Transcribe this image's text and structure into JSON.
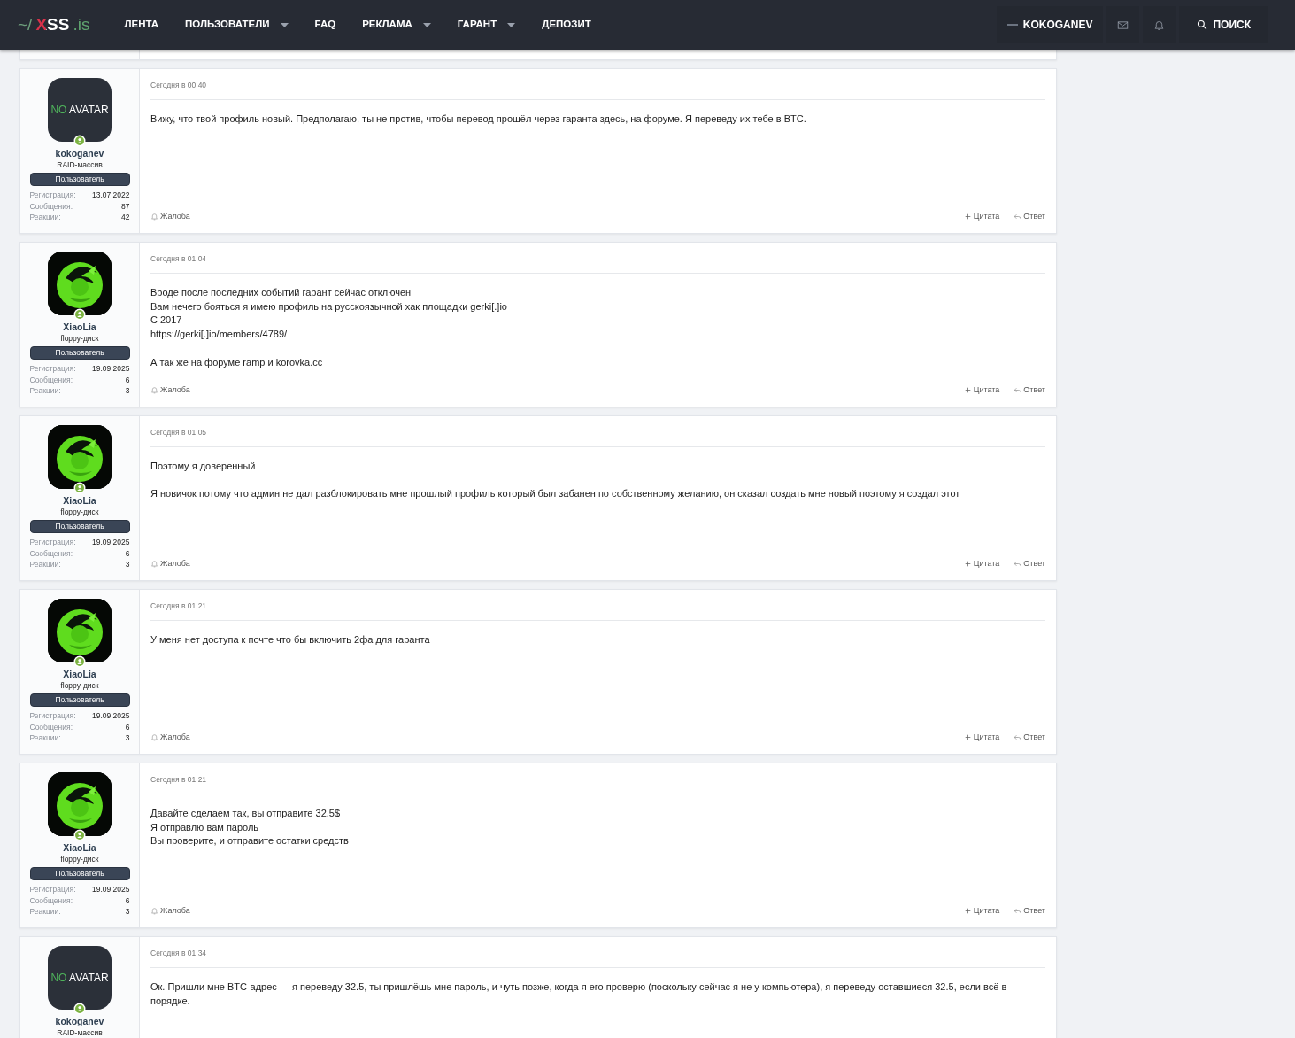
{
  "header": {
    "logo": {
      "prefix": "~/",
      "name": "XSS",
      "suffix": ".is"
    },
    "nav": [
      {
        "label": "ЛЕНТА",
        "dropdown": false
      },
      {
        "label": "ПОЛЬЗОВАТЕЛИ",
        "dropdown": true
      },
      {
        "label": "FAQ",
        "dropdown": false
      },
      {
        "label": "РЕКЛАМА",
        "dropdown": true
      },
      {
        "label": "ГАРАНТ",
        "dropdown": true
      },
      {
        "label": "ДЕПОЗИТ",
        "dropdown": false
      }
    ],
    "user": "KOKOGANEV",
    "search": "ПОИСК"
  },
  "posts": [
    {
      "avatar": {
        "kind": "text",
        "text_1": "NO",
        "text_2": "AVATAR"
      },
      "online": true,
      "name": "kokoganev",
      "title": "RAID-массив",
      "role": "Пользователь",
      "stats": [
        {
          "label": "Регистрация:",
          "value": "13.07.2022"
        },
        {
          "label": "Сообщения:",
          "value": "87"
        },
        {
          "label": "Реакции:",
          "value": "42"
        }
      ],
      "time": "Сегодня в 00:40",
      "paragraphs": [
        [
          "Вижу, что твой профиль новый. Предполагаю, ты не против, чтобы перевод прошёл через гаранта здесь, на форуме. Я переведу их тебе в BTC."
        ]
      ],
      "report": "Жалоба",
      "quote": "Цитата",
      "reply": "Ответ"
    },
    {
      "avatar": {
        "kind": "picture"
      },
      "online": true,
      "name": "XiaoLia",
      "title": "floppy-диск",
      "role": "Пользователь",
      "stats": [
        {
          "label": "Регистрация:",
          "value": "19.09.2025"
        },
        {
          "label": "Сообщения:",
          "value": "6"
        },
        {
          "label": "Реакции:",
          "value": "3"
        }
      ],
      "time": "Сегодня в 01:04",
      "paragraphs": [
        [
          "Вроде после последних событий гарант сейчас отключен",
          "Вам нечего бояться я имею профиль на русскоязычной хак площадки gerki[.]io",
          "С 2017",
          "https://gerki[.]io/members/4789/"
        ],
        [
          "А так же на форуме ramp и korovka.cc"
        ]
      ],
      "report": "Жалоба",
      "quote": "Цитата",
      "reply": "Ответ"
    },
    {
      "avatar": {
        "kind": "picture"
      },
      "online": true,
      "name": "XiaoLia",
      "title": "floppy-диск",
      "role": "Пользователь",
      "stats": [
        {
          "label": "Регистрация:",
          "value": "19.09.2025"
        },
        {
          "label": "Сообщения:",
          "value": "6"
        },
        {
          "label": "Реакции:",
          "value": "3"
        }
      ],
      "time": "Сегодня в 01:05",
      "paragraphs": [
        [
          "Поэтому я доверенный"
        ],
        [
          "Я новичок потому что админ не дал разблокировать мне прошлый профиль который был забанен по собственному желанию, он сказал создать мне новый поэтому я создал этот"
        ]
      ],
      "report": "Жалоба",
      "quote": "Цитата",
      "reply": "Ответ"
    },
    {
      "avatar": {
        "kind": "picture"
      },
      "online": true,
      "name": "XiaoLia",
      "title": "floppy-диск",
      "role": "Пользователь",
      "stats": [
        {
          "label": "Регистрация:",
          "value": "19.09.2025"
        },
        {
          "label": "Сообщения:",
          "value": "6"
        },
        {
          "label": "Реакции:",
          "value": "3"
        }
      ],
      "time": "Сегодня в 01:21",
      "paragraphs": [
        [
          "У меня нет доступа к почте что бы включить 2фа для гаранта"
        ]
      ],
      "report": "Жалоба",
      "quote": "Цитата",
      "reply": "Ответ"
    },
    {
      "avatar": {
        "kind": "picture"
      },
      "online": true,
      "name": "XiaoLia",
      "title": "floppy-диск",
      "role": "Пользователь",
      "stats": [
        {
          "label": "Регистрация:",
          "value": "19.09.2025"
        },
        {
          "label": "Сообщения:",
          "value": "6"
        },
        {
          "label": "Реакции:",
          "value": "3"
        }
      ],
      "time": "Сегодня в 01:21",
      "paragraphs": [
        [
          "Давайте сделаем так, вы отправите 32.5$",
          "Я отправлю вам пароль",
          "Вы проверите, и отправите остатки средств"
        ]
      ],
      "report": "Жалоба",
      "quote": "Цитата",
      "reply": "Ответ"
    },
    {
      "avatar": {
        "kind": "text",
        "text_1": "NO",
        "text_2": "AVATAR"
      },
      "online": true,
      "name": "kokoganev",
      "title": "RAID-массив",
      "time": "Сегодня в 01:34",
      "paragraphs": [
        [
          "Ок. Пришли мне BTC-адрес — я переведу 32.5, ты пришлёшь мне пароль, и чуть позже, когда я его проверю (поскольку сейчас я не у компьютера), я переведу оставшиеся 32.5, если всё в порядке."
        ]
      ]
    }
  ]
}
